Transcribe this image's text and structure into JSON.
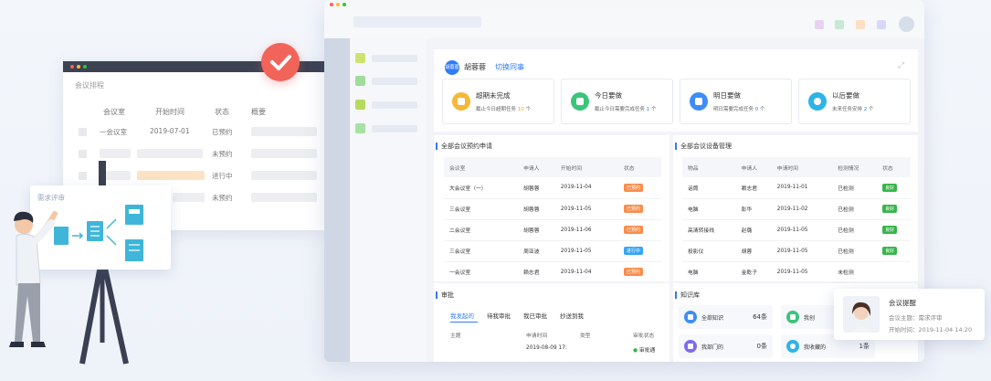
{
  "left_window": {
    "title": "会议排程",
    "headers": [
      "会议室",
      "开始时间",
      "状态",
      "概要"
    ],
    "rows": [
      {
        "room": "一会议室",
        "time": "2019-07-01",
        "status": "已预约"
      },
      {
        "room": "",
        "time": "",
        "status": "未预约"
      },
      {
        "room": "",
        "time": "",
        "status": "进行中"
      },
      {
        "room": "",
        "time": "",
        "status": "未预约"
      }
    ]
  },
  "whiteboard": {
    "title": "需求评审"
  },
  "app": {
    "user": {
      "badge": "胡蓉蓉",
      "name": "胡蓉蓉",
      "switch_label": "切换同事"
    },
    "cards": [
      {
        "title": "超期未完成",
        "sub_prefix": "截止今日超期任务",
        "count": "10",
        "sub_suffix": "个",
        "color": "#f5b93a"
      },
      {
        "title": "今日要做",
        "sub_prefix": "截止今日需要完成任务",
        "count": "1",
        "sub_suffix": "个",
        "color": "#3cc47c"
      },
      {
        "title": "明日要做",
        "sub_prefix": "明日需要完成任务",
        "count": "0",
        "sub_suffix": "个",
        "color": "#3f8cf7"
      },
      {
        "title": "以后要做",
        "sub_prefix": "未来任务安排",
        "count": "2",
        "sub_suffix": "个",
        "color": "#2fb3e6"
      }
    ],
    "booking": {
      "title": "全部会议预约申请",
      "headers": [
        "会议室",
        "申请人",
        "开始时间",
        "状态"
      ],
      "rows": [
        [
          "大会议室（一）",
          "胡蓉蓉",
          "2019-11-04",
          "已预约"
        ],
        [
          "三会议室",
          "胡蓉蓉",
          "2019-11-05",
          "已预约"
        ],
        [
          "二会议室",
          "胡蓉蓉",
          "2019-11-06",
          "已预约"
        ],
        [
          "三会议室",
          "周亚波",
          "2019-11-05",
          "进行中"
        ],
        [
          "一会议室",
          "赖志君",
          "2019-11-04",
          "已预约"
        ]
      ]
    },
    "equipment": {
      "title": "全部会议设备管理",
      "headers": [
        "物品",
        "申请人",
        "申请时间",
        "检测情况",
        "状态"
      ],
      "rows": [
        [
          "话筒",
          "赖志君",
          "2019-11-01",
          "已检测",
          "良好"
        ],
        [
          "电脑",
          "彭华",
          "2019-11-02",
          "已检测",
          "良好"
        ],
        [
          "高清转接线",
          "赵璐",
          "2019-11-05",
          "已检测",
          "良好"
        ],
        [
          "投影仪",
          "胡蓉",
          "2019-11-05",
          "已检测",
          "良好"
        ],
        [
          "电脑",
          "金乾子",
          "2019-11-05",
          "未检测",
          ""
        ]
      ]
    },
    "approval": {
      "title": "审批",
      "tabs": [
        "我发起的",
        "待我审批",
        "我已审批",
        "抄送到我"
      ],
      "headers": [
        "主题",
        "申请时间",
        "类型",
        "审批状态"
      ],
      "row": {
        "time": "2019-08-09 17:",
        "status": "审批通"
      }
    },
    "knowledge": {
      "title": "知识库",
      "items": [
        {
          "label": "全部知识",
          "count": "64条",
          "color": "#3f8cf7"
        },
        {
          "label": "我创",
          "count": "",
          "color": "#3cc47c"
        },
        {
          "label": "我部门的",
          "count": "0条",
          "color": "#7b6cf0"
        },
        {
          "label": "我收藏的",
          "count": "1条",
          "color": "#2fb3e6"
        }
      ]
    }
  },
  "notification": {
    "title": "会议提醒",
    "topic": "会议主题：需求评审",
    "start": "开始时间：2019-11-04 14:20"
  },
  "colors": {
    "accent": "#2f7cf6",
    "check_badge": "#f2635a"
  }
}
